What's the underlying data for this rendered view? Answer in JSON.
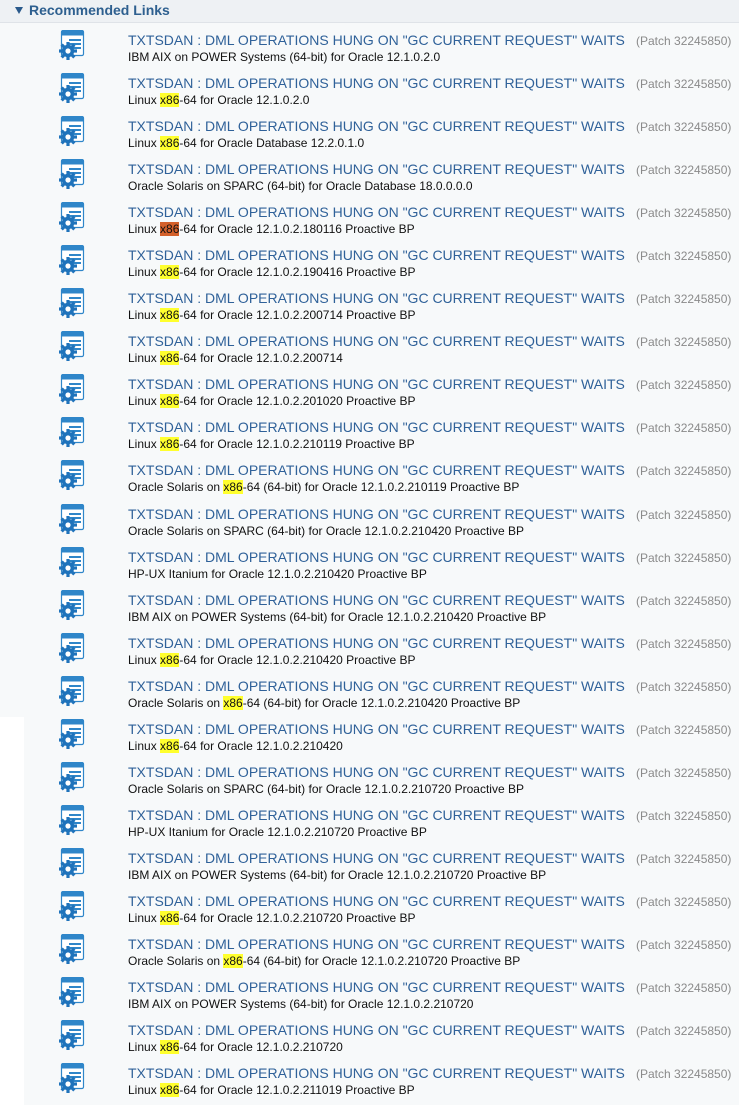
{
  "section": {
    "title": "Recommended Links"
  },
  "colors": {
    "link": "#2f6199",
    "highlight": "#ffff2e",
    "highlight_current": "#d4602a"
  },
  "icon": "patch-document-gear-icon",
  "rows": [
    {
      "title": "TXTSDAN : DML OPERATIONS HUNG ON \"GC CURRENT REQUEST\" WAITS",
      "patch": "(Patch 32245850)",
      "desc_before": "IBM AIX on POWER Systems (64-bit) for Oracle 12.1.0.2.0",
      "highlight": "",
      "desc_after": "",
      "current": false
    },
    {
      "title": "TXTSDAN : DML OPERATIONS HUNG ON \"GC CURRENT REQUEST\" WAITS",
      "patch": "(Patch 32245850)",
      "desc_before": "Linux ",
      "highlight": "x86",
      "desc_after": "-64 for Oracle 12.1.0.2.0",
      "current": false
    },
    {
      "title": "TXTSDAN : DML OPERATIONS HUNG ON \"GC CURRENT REQUEST\" WAITS",
      "patch": "(Patch 32245850)",
      "desc_before": "Linux ",
      "highlight": "x86",
      "desc_after": "-64 for Oracle Database 12.2.0.1.0",
      "current": false
    },
    {
      "title": "TXTSDAN : DML OPERATIONS HUNG ON \"GC CURRENT REQUEST\" WAITS",
      "patch": "(Patch 32245850)",
      "desc_before": "Oracle Solaris on SPARC (64-bit) for Oracle Database 18.0.0.0.0",
      "highlight": "",
      "desc_after": "",
      "current": false
    },
    {
      "title": "TXTSDAN : DML OPERATIONS HUNG ON \"GC CURRENT REQUEST\" WAITS",
      "patch": "(Patch 32245850)",
      "desc_before": "Linux ",
      "highlight": "x86",
      "desc_after": "-64 for Oracle 12.1.0.2.180116 Proactive BP",
      "current": true
    },
    {
      "title": "TXTSDAN : DML OPERATIONS HUNG ON \"GC CURRENT REQUEST\" WAITS",
      "patch": "(Patch 32245850)",
      "desc_before": "Linux ",
      "highlight": "x86",
      "desc_after": "-64 for Oracle 12.1.0.2.190416 Proactive BP",
      "current": false
    },
    {
      "title": "TXTSDAN : DML OPERATIONS HUNG ON \"GC CURRENT REQUEST\" WAITS",
      "patch": "(Patch 32245850)",
      "desc_before": "Linux ",
      "highlight": "x86",
      "desc_after": "-64 for Oracle 12.1.0.2.200714 Proactive BP",
      "current": false
    },
    {
      "title": "TXTSDAN : DML OPERATIONS HUNG ON \"GC CURRENT REQUEST\" WAITS",
      "patch": "(Patch 32245850)",
      "desc_before": "Linux ",
      "highlight": "x86",
      "desc_after": "-64 for Oracle 12.1.0.2.200714",
      "current": false
    },
    {
      "title": "TXTSDAN : DML OPERATIONS HUNG ON \"GC CURRENT REQUEST\" WAITS",
      "patch": "(Patch 32245850)",
      "desc_before": "Linux ",
      "highlight": "x86",
      "desc_after": "-64 for Oracle 12.1.0.2.201020 Proactive BP",
      "current": false
    },
    {
      "title": "TXTSDAN : DML OPERATIONS HUNG ON \"GC CURRENT REQUEST\" WAITS",
      "patch": "(Patch 32245850)",
      "desc_before": "Linux ",
      "highlight": "x86",
      "desc_after": "-64 for Oracle 12.1.0.2.210119 Proactive BP",
      "current": false
    },
    {
      "title": "TXTSDAN : DML OPERATIONS HUNG ON \"GC CURRENT REQUEST\" WAITS",
      "patch": "(Patch 32245850)",
      "desc_before": "Oracle Solaris on ",
      "highlight": "x86",
      "desc_after": "-64 (64-bit) for Oracle 12.1.0.2.210119 Proactive BP",
      "current": false
    },
    {
      "title": "TXTSDAN : DML OPERATIONS HUNG ON \"GC CURRENT REQUEST\" WAITS",
      "patch": "(Patch 32245850)",
      "desc_before": "Oracle Solaris on SPARC (64-bit) for Oracle 12.1.0.2.210420 Proactive BP",
      "highlight": "",
      "desc_after": "",
      "current": false
    },
    {
      "title": "TXTSDAN : DML OPERATIONS HUNG ON \"GC CURRENT REQUEST\" WAITS",
      "patch": "(Patch 32245850)",
      "desc_before": "HP-UX Itanium for Oracle 12.1.0.2.210420 Proactive BP",
      "highlight": "",
      "desc_after": "",
      "current": false
    },
    {
      "title": "TXTSDAN : DML OPERATIONS HUNG ON \"GC CURRENT REQUEST\" WAITS",
      "patch": "(Patch 32245850)",
      "desc_before": "IBM AIX on POWER Systems (64-bit) for Oracle 12.1.0.2.210420 Proactive BP",
      "highlight": "",
      "desc_after": "",
      "current": false
    },
    {
      "title": "TXTSDAN : DML OPERATIONS HUNG ON \"GC CURRENT REQUEST\" WAITS",
      "patch": "(Patch 32245850)",
      "desc_before": "Linux ",
      "highlight": "x86",
      "desc_after": "-64 for Oracle 12.1.0.2.210420 Proactive BP",
      "current": false
    },
    {
      "title": "TXTSDAN : DML OPERATIONS HUNG ON \"GC CURRENT REQUEST\" WAITS",
      "patch": "(Patch 32245850)",
      "desc_before": "Oracle Solaris on ",
      "highlight": "x86",
      "desc_after": "-64 (64-bit) for Oracle 12.1.0.2.210420 Proactive BP",
      "current": false
    },
    {
      "title": "TXTSDAN : DML OPERATIONS HUNG ON \"GC CURRENT REQUEST\" WAITS",
      "patch": "(Patch 32245850)",
      "desc_before": "Linux ",
      "highlight": "x86",
      "desc_after": "-64 for Oracle 12.1.0.2.210420",
      "current": false
    },
    {
      "title": "TXTSDAN : DML OPERATIONS HUNG ON \"GC CURRENT REQUEST\" WAITS",
      "patch": "(Patch 32245850)",
      "desc_before": "Oracle Solaris on SPARC (64-bit) for Oracle 12.1.0.2.210720 Proactive BP",
      "highlight": "",
      "desc_after": "",
      "current": false
    },
    {
      "title": "TXTSDAN : DML OPERATIONS HUNG ON \"GC CURRENT REQUEST\" WAITS",
      "patch": "(Patch 32245850)",
      "desc_before": "HP-UX Itanium for Oracle 12.1.0.2.210720 Proactive BP",
      "highlight": "",
      "desc_after": "",
      "current": false
    },
    {
      "title": "TXTSDAN : DML OPERATIONS HUNG ON \"GC CURRENT REQUEST\" WAITS",
      "patch": "(Patch 32245850)",
      "desc_before": "IBM AIX on POWER Systems (64-bit) for Oracle 12.1.0.2.210720 Proactive BP",
      "highlight": "",
      "desc_after": "",
      "current": false
    },
    {
      "title": "TXTSDAN : DML OPERATIONS HUNG ON \"GC CURRENT REQUEST\" WAITS",
      "patch": "(Patch 32245850)",
      "desc_before": "Linux ",
      "highlight": "x86",
      "desc_after": "-64 for Oracle 12.1.0.2.210720 Proactive BP",
      "current": false
    },
    {
      "title": "TXTSDAN : DML OPERATIONS HUNG ON \"GC CURRENT REQUEST\" WAITS",
      "patch": "(Patch 32245850)",
      "desc_before": "Oracle Solaris on ",
      "highlight": "x86",
      "desc_after": "-64 (64-bit) for Oracle 12.1.0.2.210720 Proactive BP",
      "current": false
    },
    {
      "title": "TXTSDAN : DML OPERATIONS HUNG ON \"GC CURRENT REQUEST\" WAITS",
      "patch": "(Patch 32245850)",
      "desc_before": "IBM AIX on POWER Systems (64-bit) for Oracle 12.1.0.2.210720",
      "highlight": "",
      "desc_after": "",
      "current": false
    },
    {
      "title": "TXTSDAN : DML OPERATIONS HUNG ON \"GC CURRENT REQUEST\" WAITS",
      "patch": "(Patch 32245850)",
      "desc_before": "Linux ",
      "highlight": "x86",
      "desc_after": "-64 for Oracle 12.1.0.2.210720",
      "current": false
    },
    {
      "title": "TXTSDAN : DML OPERATIONS HUNG ON \"GC CURRENT REQUEST\" WAITS",
      "patch": "(Patch 32245850)",
      "desc_before": "Linux ",
      "highlight": "x86",
      "desc_after": "-64 for Oracle 12.1.0.2.211019 Proactive BP",
      "current": false
    }
  ]
}
